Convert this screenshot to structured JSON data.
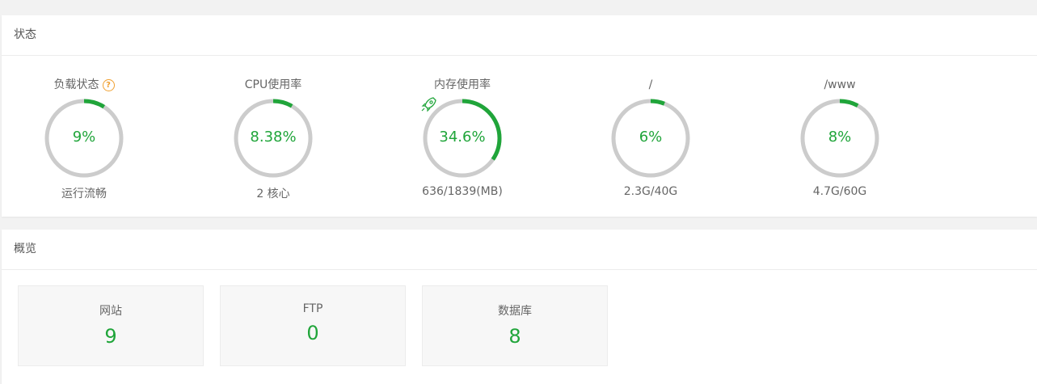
{
  "status": {
    "title": "状态",
    "gauges": [
      {
        "label": "负载状态",
        "value": "9%",
        "fraction": 0.09,
        "sub": "运行流畅",
        "help": true
      },
      {
        "label": "CPU使用率",
        "value": "8.38%",
        "fraction": 0.0838,
        "sub": "2 核心"
      },
      {
        "label": "内存使用率",
        "value": "34.6%",
        "fraction": 0.346,
        "sub": "636/1839(MB)",
        "icon": "rocket-icon"
      },
      {
        "label": "/",
        "value": "6%",
        "fraction": 0.06,
        "sub": "2.3G/40G"
      },
      {
        "label": "/www",
        "value": "8%",
        "fraction": 0.08,
        "sub": "4.7G/60G"
      }
    ]
  },
  "overview": {
    "title": "概览",
    "cards": [
      {
        "label": "网站",
        "count": "9"
      },
      {
        "label": "FTP",
        "count": "0"
      },
      {
        "label": "数据库",
        "count": "8"
      }
    ]
  },
  "colors": {
    "accent": "#20a53a",
    "track": "#cccccc",
    "help": "#f0a030"
  }
}
